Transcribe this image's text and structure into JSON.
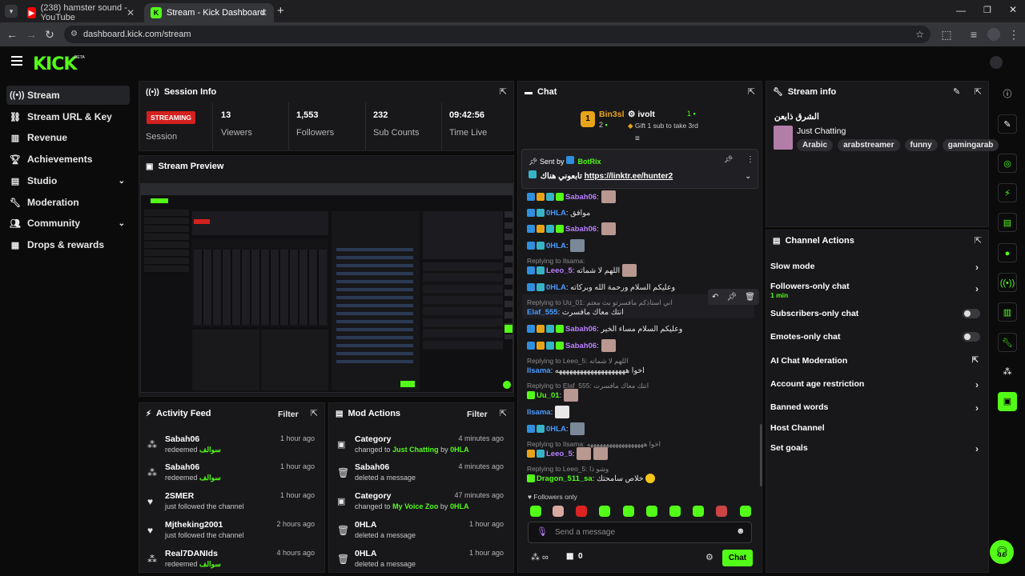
{
  "browser": {
    "tabs": [
      {
        "title": "(238) hamster sound - YouTube"
      },
      {
        "title": "Stream - Kick Dashboard"
      }
    ],
    "url": "dashboard.kick.com/stream"
  },
  "brand": {
    "logo": "KICK",
    "beta": "BETA",
    "accent": "#53fc18"
  },
  "sidebar": {
    "items": [
      {
        "label": "Stream",
        "icon": "radio-icon"
      },
      {
        "label": "Stream URL & Key",
        "icon": "link-icon"
      },
      {
        "label": "Revenue",
        "icon": "chart-icon"
      },
      {
        "label": "Achievements",
        "icon": "trophy-icon"
      },
      {
        "label": "Studio",
        "icon": "layers-icon"
      },
      {
        "label": "Moderation",
        "icon": "wrench-icon"
      },
      {
        "label": "Community",
        "icon": "users-icon"
      },
      {
        "label": "Drops & rewards",
        "icon": "gift-icon"
      }
    ]
  },
  "session": {
    "title": "Session Info",
    "status": "STREAMING",
    "status_label": "Session",
    "stats": [
      {
        "value": "13",
        "label": "Viewers"
      },
      {
        "value": "1,553",
        "label": "Followers"
      },
      {
        "value": "232",
        "label": "Sub Counts"
      },
      {
        "value": "09:42:56",
        "label": "Time Live"
      }
    ]
  },
  "preview": {
    "title": "Stream Preview"
  },
  "activity": {
    "title": "Activity Feed",
    "filter": "Filter",
    "items": [
      {
        "name": "Sabah06",
        "action": "redeemed",
        "reward": "سوالف",
        "time": "1 hour ago"
      },
      {
        "name": "Sabah06",
        "action": "redeemed",
        "reward": "سوالف",
        "time": "1 hour ago"
      },
      {
        "name": "2SMER",
        "action": "just followed the channel",
        "reward": "",
        "time": "1 hour ago"
      },
      {
        "name": "Mjtheking2001",
        "action": "just followed the channel",
        "reward": "",
        "time": "2 hours ago"
      },
      {
        "name": "Real7DANIds",
        "action": "redeemed",
        "reward": "سوالف",
        "time": "4 hours ago"
      }
    ]
  },
  "mod": {
    "title": "Mod Actions",
    "filter": "Filter",
    "items": [
      {
        "name": "Category",
        "pre": "changed to",
        "hl": "Just Chatting",
        "by": "by",
        "who": "0HLA",
        "time": "4 minutes ago"
      },
      {
        "name": "Sabah06",
        "pre": "deleted a message",
        "hl": "",
        "by": "",
        "who": "",
        "time": "4 minutes ago"
      },
      {
        "name": "Category",
        "pre": "changed to",
        "hl": "My Voice Zoo",
        "by": "by",
        "who": "0HLA",
        "time": "47 minutes ago"
      },
      {
        "name": "0HLA",
        "pre": "deleted a message",
        "hl": "",
        "by": "",
        "who": "",
        "time": "1 hour ago"
      },
      {
        "name": "0HLA",
        "pre": "deleted a message",
        "hl": "",
        "by": "",
        "who": "",
        "time": "1 hour ago"
      }
    ]
  },
  "chat": {
    "title": "Chat",
    "leaderboard": [
      {
        "rank": "1",
        "name": "Bin3sl",
        "count": "2"
      },
      {
        "name": "ivolt",
        "count": "1",
        "note": "Gift 1 sub to take 3rd"
      }
    ],
    "pinned": {
      "sent_by": "Sent by",
      "sender": "BotRix",
      "text": "تابعوني هناك",
      "link": "https://linktr.ee/hunter2"
    },
    "messages": [
      {
        "user": "Sabah06",
        "color": "#b980ff",
        "text": ""
      },
      {
        "user": "0HLA",
        "color": "#4b9bff",
        "text": "موافق"
      },
      {
        "user": "Sabah06",
        "color": "#b980ff",
        "text": ""
      },
      {
        "user": "0HLA",
        "color": "#4b9bff",
        "text": ""
      },
      {
        "reply": "Replying to Ilsama:"
      },
      {
        "user": "Leeo_5",
        "color": "#b980ff",
        "text": "اللهم لا شماته"
      },
      {
        "user": "0HLA",
        "color": "#4b9bff",
        "text": "وعليكم السلام ورحمة الله وبركاته"
      },
      {
        "reply": "Replying to Uu_01: اني استاذكم مافسرتو بث معتم"
      },
      {
        "user": "Elaf_555",
        "color": "#4b9bff",
        "text": "انتك معاك مافسرت"
      },
      {
        "user": "Sabah06",
        "color": "#b980ff",
        "text": "وعليكم السلام مساء الخير"
      },
      {
        "user": "Sabah06",
        "color": "#b980ff",
        "text": ""
      },
      {
        "reply": "Replying to Leeo_5: اللهم لا شماته"
      },
      {
        "user": "Ilsama",
        "color": "#4b9bff",
        "text": "اخوا ههههههههههههههههههههه"
      },
      {
        "reply": "Replying to Elaf_555: انتك معاك مافسرت"
      },
      {
        "user": "Uu_01",
        "color": "#53fc18",
        "text": ""
      },
      {
        "user": "Ilsama",
        "color": "#4b9bff",
        "text": ""
      },
      {
        "user": "0HLA",
        "color": "#4b9bff",
        "text": ""
      },
      {
        "reply": "Replying to Ilsama: اخوا ههههههههههههههههههه"
      },
      {
        "user": "Leeo_5",
        "color": "#b980ff",
        "text": ""
      },
      {
        "reply": "Replying to Leeo_5: وشو ذا"
      },
      {
        "user": "Dragon_511_sa",
        "color": "#53fc18",
        "text": "خلاص سامحتك"
      }
    ],
    "followers_only": "Followers only",
    "placeholder": "Send a message",
    "viewer_count": "0",
    "send": "Chat"
  },
  "stream_info": {
    "title": "Stream info",
    "stream_title": "الشرق ذايعن",
    "category": "Just Chatting",
    "tags": [
      "Arabic",
      "arabstreamer",
      "funny",
      "gamingarab"
    ]
  },
  "actions": {
    "title": "Channel Actions",
    "items": [
      {
        "label": "Slow mode",
        "sub": "",
        "ctl": "chevron"
      },
      {
        "label": "Followers-only chat",
        "sub": "1 min",
        "ctl": "chevron"
      },
      {
        "label": "Subscribers-only chat",
        "sub": "",
        "ctl": "toggle"
      },
      {
        "label": "Emotes-only chat",
        "sub": "",
        "ctl": "toggle"
      },
      {
        "label": "AI Chat Moderation",
        "sub": "",
        "ctl": "external"
      },
      {
        "label": "Account age restriction",
        "sub": "",
        "ctl": "chevron"
      },
      {
        "label": "Banned words",
        "sub": "",
        "ctl": "chevron"
      },
      {
        "label": "Host Channel",
        "sub": "",
        "ctl": "none"
      },
      {
        "label": "Set goals",
        "sub": "",
        "ctl": "chevron"
      }
    ]
  }
}
